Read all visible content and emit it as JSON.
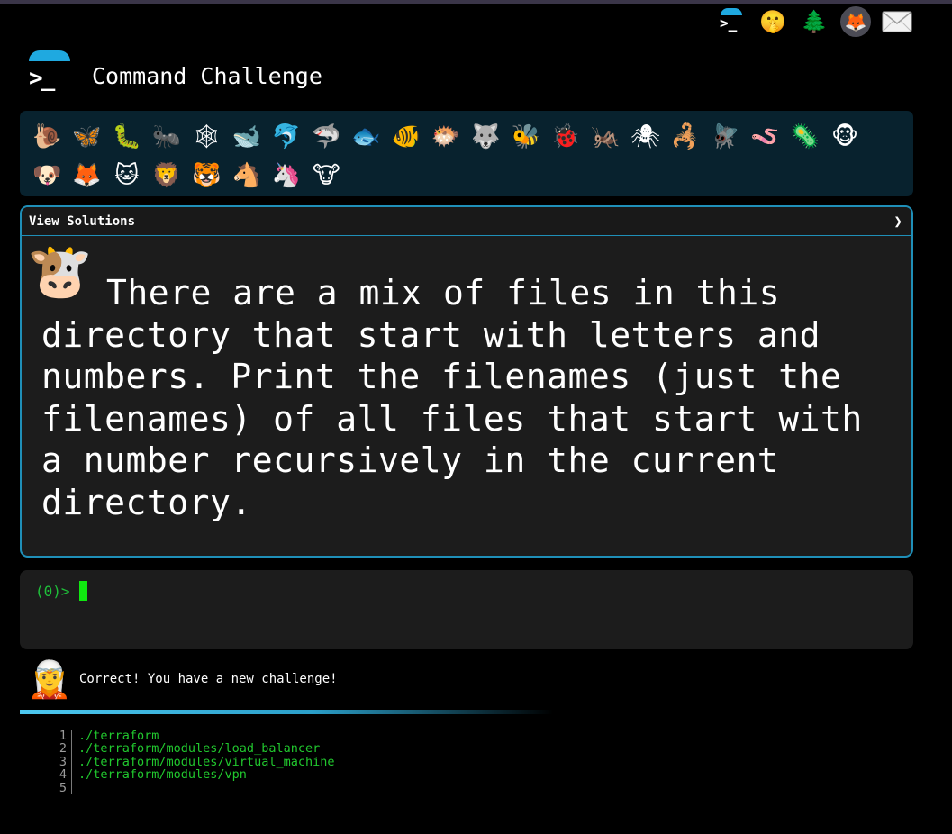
{
  "header": {
    "logo_text": ">_",
    "title": "Command Challenge"
  },
  "top_icons": [
    {
      "name": "command-challenge-logo-icon",
      "glyph": ">_"
    },
    {
      "name": "shushing-face-icon",
      "glyph": "🤫"
    },
    {
      "name": "evergreen-tree-icon",
      "glyph": "🌲"
    },
    {
      "name": "gitlab-icon",
      "glyph": "🦊"
    },
    {
      "name": "envelope-icon",
      "glyph": "✉"
    }
  ],
  "animals": [
    {
      "name": "snail-icon",
      "glyph": "🐌"
    },
    {
      "name": "butterfly-icon",
      "glyph": "🦋"
    },
    {
      "name": "caterpillar-icon",
      "glyph": "🐛"
    },
    {
      "name": "ant-icon",
      "glyph": "🐜"
    },
    {
      "name": "spider-web-icon",
      "glyph": "🕸"
    },
    {
      "name": "whale-icon",
      "glyph": "🐋"
    },
    {
      "name": "dolphin-icon",
      "glyph": "🐬"
    },
    {
      "name": "shark-icon",
      "glyph": "🦈"
    },
    {
      "name": "fish-icon",
      "glyph": "🐟"
    },
    {
      "name": "tropical-fish-icon",
      "glyph": "🐠"
    },
    {
      "name": "blowfish-icon",
      "glyph": "🐡"
    },
    {
      "name": "wolf-icon",
      "glyph": "🐺"
    },
    {
      "name": "bee-icon",
      "glyph": "🐝"
    },
    {
      "name": "ladybug-icon",
      "glyph": "🐞"
    },
    {
      "name": "cricket-icon",
      "glyph": "🦗"
    },
    {
      "name": "spider-icon",
      "glyph": "🕷"
    },
    {
      "name": "scorpion-icon",
      "glyph": "🦂"
    },
    {
      "name": "fly-icon",
      "glyph": "🪰"
    },
    {
      "name": "worm-icon",
      "glyph": "🪱"
    },
    {
      "name": "microbe-icon",
      "glyph": "🦠"
    },
    {
      "name": "monkey-icon",
      "glyph": "🐵"
    },
    {
      "name": "dog-icon",
      "glyph": "🐶"
    },
    {
      "name": "fox-icon",
      "glyph": "🦊"
    },
    {
      "name": "cat-icon",
      "glyph": "🐱"
    },
    {
      "name": "lion-icon",
      "glyph": "🦁"
    },
    {
      "name": "tiger-icon",
      "glyph": "🐯"
    },
    {
      "name": "horse-icon",
      "glyph": "🐴"
    },
    {
      "name": "unicorn-icon",
      "glyph": "🦄"
    },
    {
      "name": "cow-icon",
      "glyph": "🐮"
    }
  ],
  "card": {
    "header_label": "View Solutions",
    "chevron": "❯",
    "badge_glyph": "🐮",
    "challenge_text": "There are a mix of files in this directory that start with letters and numbers. Print the filenames (just the filenames) of all files that start with a number recursively in the current directory."
  },
  "terminal": {
    "prompt": "(0)>"
  },
  "status": {
    "avatar_glyph": "🧝",
    "message": "Correct! You have a new challenge!"
  },
  "output": {
    "lines": [
      {
        "num": "1",
        "text": "./terraform"
      },
      {
        "num": "2",
        "text": "./terraform/modules/load_balancer"
      },
      {
        "num": "3",
        "text": "./terraform/modules/virtual_machine"
      },
      {
        "num": "4",
        "text": "./terraform/modules/vpn"
      },
      {
        "num": "5",
        "text": ""
      }
    ]
  },
  "colors": {
    "accent": "#1fa9e0",
    "card_border": "#1f8fb8",
    "prompt_green": "#1fbf3a",
    "output_green": "#21c72e",
    "panel_bg": "#08222e"
  }
}
